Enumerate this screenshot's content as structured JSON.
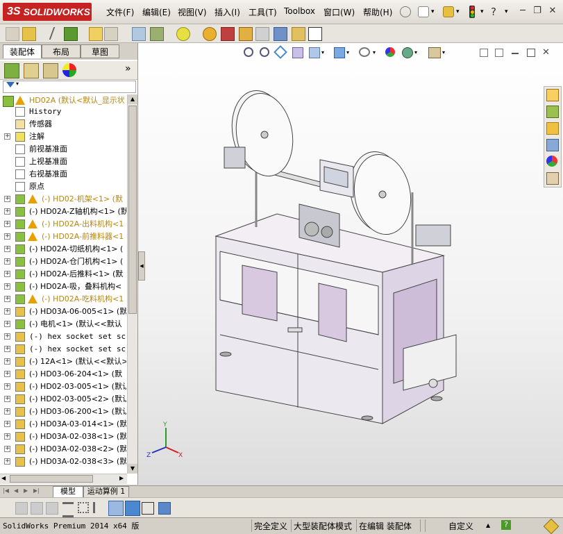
{
  "app": {
    "logo_ds": "3S",
    "logo_text": "SOLIDWORKS"
  },
  "menu": [
    {
      "label": "文件(F)"
    },
    {
      "label": "编辑(E)"
    },
    {
      "label": "视图(V)"
    },
    {
      "label": "插入(I)"
    },
    {
      "label": "工具(T)"
    },
    {
      "label": "Toolbox"
    },
    {
      "label": "窗口(W)"
    },
    {
      "label": "帮助(H)"
    }
  ],
  "help_glyph": "?",
  "window_buttons": {
    "minimize": "─",
    "restore": "❐",
    "close": "✕"
  },
  "left_tabs": {
    "assembly": "装配体",
    "layout": "布局",
    "sketch": "草图"
  },
  "panel_expand": "»",
  "tree": {
    "root": "HD02A  (默认<默认_显示状",
    "items": [
      {
        "label": "History",
        "kind": "history",
        "mono": true,
        "expander": false
      },
      {
        "label": "传感器",
        "kind": "sensor",
        "expander": false
      },
      {
        "label": "注解",
        "kind": "annotation",
        "expander": true
      },
      {
        "label": "前视基准面",
        "kind": "plane",
        "expander": false
      },
      {
        "label": "上视基准面",
        "kind": "plane",
        "expander": false
      },
      {
        "label": "右视基准面",
        "kind": "plane",
        "expander": false
      },
      {
        "label": "原点",
        "kind": "origin",
        "expander": false
      },
      {
        "label": "(-) HD02-机架<1> (默",
        "kind": "asm",
        "warn": true
      },
      {
        "label": "(-) HD02A-Z轴机构<1> (默",
        "kind": "asm"
      },
      {
        "label": "(-) HD02A-出料机构<1",
        "kind": "asm",
        "warn": true
      },
      {
        "label": "(-) HD02A-前推料器<1",
        "kind": "asm",
        "warn": true
      },
      {
        "label": "(-) HD02A-切纸机构<1> (",
        "kind": "asm"
      },
      {
        "label": "(-) HD02A-仓门机构<1> (",
        "kind": "asm"
      },
      {
        "label": "(-) HD02A-后推料<1> (默",
        "kind": "asm"
      },
      {
        "label": "(-) HD02A-吸，叠料机构<",
        "kind": "asm"
      },
      {
        "label": "(-) HD02A-吃料机构<1",
        "kind": "asm",
        "warn": true
      },
      {
        "label": "(-) HD03A-06-005<1> (默",
        "kind": "part"
      },
      {
        "label": "(-) 电机<1> (默认<<默认",
        "kind": "asm"
      },
      {
        "label": "(-) hex socket set scre",
        "kind": "part",
        "mono": true
      },
      {
        "label": "(-) hex socket set scre",
        "kind": "part",
        "mono": true
      },
      {
        "label": "(-) 12A<1> (默认<<默认>",
        "kind": "part"
      },
      {
        "label": "(-) HD03-06-204<1> (默",
        "kind": "part"
      },
      {
        "label": "(-) HD02-03-005<1> (默认",
        "kind": "part"
      },
      {
        "label": "(-) HD02-03-005<2> (默认",
        "kind": "part"
      },
      {
        "label": "(-) HD03-06-200<1> (默认",
        "kind": "part"
      },
      {
        "label": "(-) HD03A-03-014<1> (默",
        "kind": "part"
      },
      {
        "label": "(-) HD03A-02-038<1> (默",
        "kind": "part"
      },
      {
        "label": "(-) HD03A-02-038<2> (默",
        "kind": "part"
      },
      {
        "label": "(-) HD03A-02-038<3> (默",
        "kind": "part"
      }
    ]
  },
  "bottom_tabs": {
    "model": "模型",
    "motion": "运动算例 1"
  },
  "status": {
    "product": "SolidWorks Premium 2014 x64 版",
    "defined": "完全定义",
    "mode": "大型装配体模式",
    "editing": "在编辑 装配体",
    "units": "自定义",
    "units_arrow": "▲",
    "help_glyph": "?"
  },
  "axis": {
    "x": "X",
    "y": "Y",
    "z": "Z"
  },
  "colors": {
    "accent_red": "#c62222",
    "machine_body": "#e4dcea",
    "machine_line": "#444444",
    "warn": "#e8a000"
  }
}
